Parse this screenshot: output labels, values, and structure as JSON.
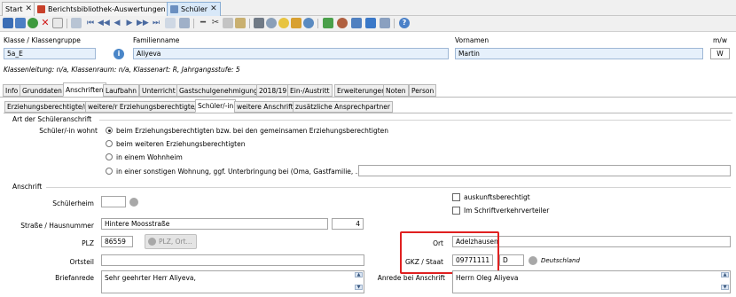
{
  "doc_tabs": [
    {
      "label": "Start"
    },
    {
      "label": "Berichtsbibliothek-Auswertungen"
    },
    {
      "label": "Schüler"
    }
  ],
  "header": {
    "klasse_label": "Klasse / Klassengruppe",
    "klasse_value": "5a_E",
    "familienname_label": "Familienname",
    "familienname_value": "Aliyeva",
    "vornamen_label": "Vornamen",
    "vornamen_value": "Martin",
    "mw_label": "m/w",
    "mw_value": "W",
    "klassenleitung": "Klassenleitung: n/a, Klassenraum: n/a, Klassenart: R, Jahrgangsstufe: 5"
  },
  "main_tabs": [
    "Info",
    "Grunddaten",
    "Anschriften",
    "Laufbahn",
    "Unterricht",
    "Gastschulgenehmigung",
    "2018/19",
    "Ein-/Austritt",
    "Erweiterungen",
    "Noten",
    "Person"
  ],
  "sub_tabs": [
    "Erziehungsberechtigte/r",
    "weitere/r Erziehungsberechtigte/r",
    "Schüler/-in",
    "weitere Anschrift",
    "zusätzliche Ansprechpartner"
  ],
  "art": {
    "section_title": "Art der Schüleranschrift",
    "wohnt_label": "Schüler/-in wohnt",
    "options": [
      "beim Erziehungsberechtigten bzw. bei den gemeinsamen Erziehungsberechtigten",
      "beim weiteren Erziehungsberechtigten",
      "in einem Wohnheim",
      "in einer sonstigen Wohnung, ggf. Unterbringung bei (Oma, Gastfamilie, ...)"
    ],
    "sonstige_value": ""
  },
  "anschrift": {
    "section_title": "Anschrift",
    "schuelerheim_label": "Schülerheim",
    "schuelerheim_value": "",
    "auskunft_label": "auskunftsberechtigt",
    "schriftverkehr_label": "Im Schriftverkehrverteiler",
    "strasse_label": "Straße / Hausnummer",
    "strasse_value": "Hintere Moosstraße",
    "hausnummer_value": "4",
    "plz_label": "PLZ",
    "plz_value": "86559",
    "plz_ort_button": "PLZ, Ort...",
    "ort_label": "Ort",
    "ort_value": "Adelzhausen",
    "ortsteil_label": "Ortsteil",
    "ortsteil_value": "",
    "gkz_label": "GKZ / Staat",
    "gkz_value": "09771111",
    "staat_value": "D",
    "staat_name": "Deutschland",
    "briefanrede_label": "Briefanrede",
    "briefanrede_value": "Sehr geehrter Herr Aliyeva,",
    "anrede_label": "Anrede bei Anschrift",
    "anrede_value": "Herrn Oleg Aliyeva"
  },
  "colors": {
    "highlight_box": "#e02020",
    "active_tab": "#d8e8f8",
    "toolbar_bg": "#f0f0f0"
  }
}
